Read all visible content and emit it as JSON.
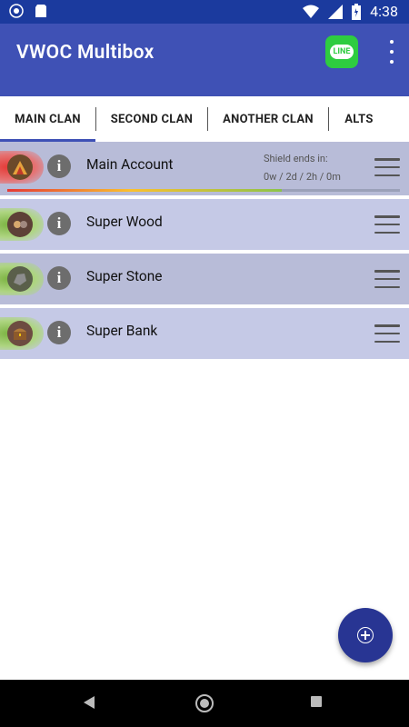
{
  "status_bar": {
    "time": "4:38"
  },
  "app": {
    "title": "VWOC Multibox",
    "line_label": "LINE"
  },
  "tabs": [
    {
      "label": "MAIN CLAN",
      "active": true
    },
    {
      "label": "SECOND CLAN",
      "active": false
    },
    {
      "label": "ANOTHER CLAN",
      "active": false
    },
    {
      "label": "ALTS",
      "active": false
    }
  ],
  "accounts": [
    {
      "name": "Main Account",
      "shield_label": "Shield ends in:",
      "shield_value": "0w / 2d / 2h / 0m",
      "shield_progress": 0.7,
      "glow_color": "#e53935"
    },
    {
      "name": "Super Wood",
      "glow_color": "#7cb342"
    },
    {
      "name": "Super Stone",
      "glow_color": "#7cb342"
    },
    {
      "name": "Super Bank",
      "glow_color": "#7cb342"
    }
  ],
  "icons": {
    "info": "info-icon",
    "drag": "hamburger-icon",
    "fab": "add-icon"
  }
}
